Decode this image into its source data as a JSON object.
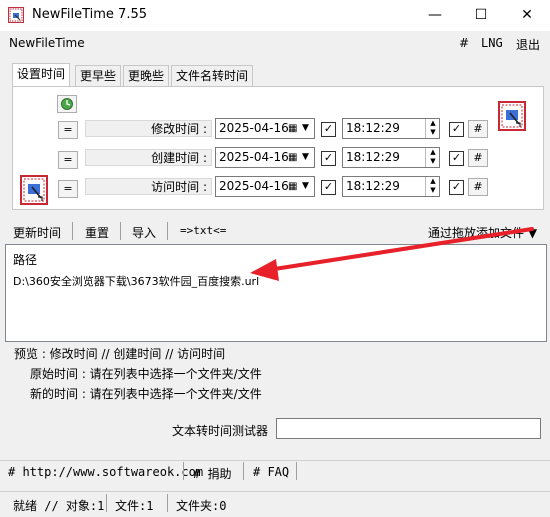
{
  "window": {
    "title": "NewFileTime 7.55",
    "minimize": "—",
    "maximize": "☐",
    "close": "✕"
  },
  "menubar": {
    "app_name": "NewFileTime",
    "hash": "#",
    "lng": "LNG",
    "exit": "退出"
  },
  "tabs": [
    {
      "label": "设置时间",
      "active": true
    },
    {
      "label": "更早些"
    },
    {
      "label": "更晚些"
    },
    {
      "label": "文件名转时间"
    }
  ],
  "rows": [
    {
      "eq": "=",
      "label": "修改时间 :",
      "date": "2025-04-16",
      "time": "18:12:29",
      "hash": "#"
    },
    {
      "eq": "=",
      "label": "创建时间 :",
      "date": "2025-04-16",
      "time": "18:12:29",
      "hash": "#"
    },
    {
      "eq": "=",
      "label": "访问时间 :",
      "date": "2025-04-16",
      "time": "18:12:29",
      "hash": "#"
    }
  ],
  "toolbar": {
    "update": "更新时间",
    "reset": "重置",
    "import": "导入",
    "txt": "=>txt<=",
    "drag_add": "通过拖放添加文件 ▼"
  },
  "list": {
    "header": "路径",
    "items": [
      "D:\\360安全浏览器下载\\3673软件园_百度搜索.url"
    ]
  },
  "preview": {
    "line1": "预览 :   修改时间   //   创建时间   //   访问时间",
    "original": "原始时间 : 请在列表中选择一个文件夹/文件",
    "new": "新的时间 : 请在列表中选择一个文件夹/文件"
  },
  "tester": {
    "label": "文本转时间测试器",
    "value": ""
  },
  "footer": {
    "website": "# http://www.softwareok.com",
    "donate": "# 捐助",
    "faq": "# FAQ"
  },
  "status": {
    "ready": "就绪 // 对象:1",
    "files": "文件:1",
    "folders": "文件夹:0"
  },
  "colors": {
    "arrow": "#e8202a",
    "title_bg": "#ffffff",
    "window_bg": "#f0f0f0"
  }
}
